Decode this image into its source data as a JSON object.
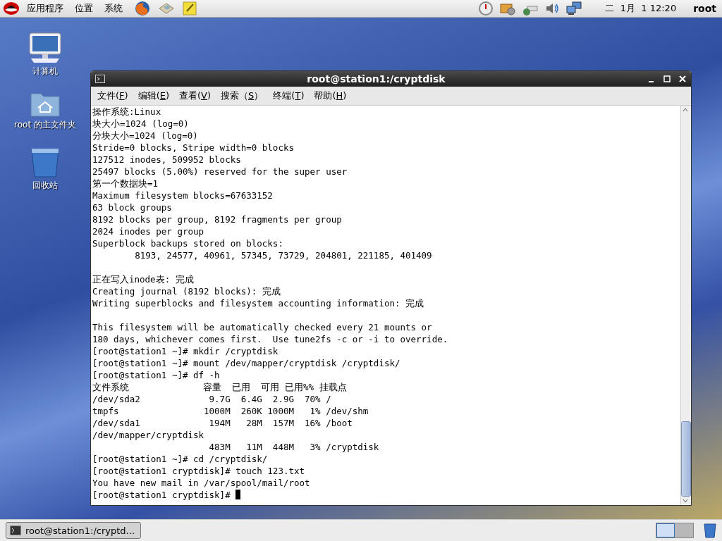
{
  "top_panel": {
    "menus": [
      "应用程序",
      "位置",
      "系统"
    ],
    "clock": "二  1月  1 12:20",
    "user": "root"
  },
  "desktop_icons": [
    {
      "kind": "computer",
      "label": "计算机"
    },
    {
      "kind": "home",
      "label": "root 的主文件夹"
    },
    {
      "kind": "trash",
      "label": "回收站"
    }
  ],
  "window": {
    "title": "root@station1:/cryptdisk",
    "menu": [
      {
        "before": "文件(",
        "key": "F",
        "after": ")"
      },
      {
        "before": "编辑(",
        "key": "E",
        "after": ")"
      },
      {
        "before": "查看(",
        "key": "V",
        "after": ")"
      },
      {
        "before": "搜索（",
        "key": "S",
        "after": "）"
      },
      {
        "before": "终端(",
        "key": "T",
        "after": ")"
      },
      {
        "before": "帮助(",
        "key": "H",
        "after": ")"
      }
    ],
    "terminal": {
      "cursor_visible": true,
      "lines": [
        {
          "kind": "text",
          "text": "操作系统:Linux"
        },
        {
          "kind": "text",
          "text": "块大小=1024 (log=0)"
        },
        {
          "kind": "text",
          "text": "分块大小=1024 (log=0)"
        },
        {
          "kind": "text",
          "text": "Stride=0 blocks, Stripe width=0 blocks"
        },
        {
          "kind": "text",
          "text": "127512 inodes, 509952 blocks"
        },
        {
          "kind": "text",
          "text": "25497 blocks (5.00%) reserved for the super user"
        },
        {
          "kind": "text",
          "text": "第一个数据块=1"
        },
        {
          "kind": "text",
          "text": "Maximum filesystem blocks=67633152"
        },
        {
          "kind": "text",
          "text": "63 block groups"
        },
        {
          "kind": "text",
          "text": "8192 blocks per group, 8192 fragments per group"
        },
        {
          "kind": "text",
          "text": "2024 inodes per group"
        },
        {
          "kind": "text",
          "text": "Superblock backups stored on blocks:"
        },
        {
          "kind": "text",
          "text": "        8193, 24577, 40961, 57345, 73729, 204801, 221185, 401409"
        },
        {
          "kind": "blank"
        },
        {
          "kind": "text",
          "text": "正在写入inode表: 完成"
        },
        {
          "kind": "text",
          "text": "Creating journal (8192 blocks): 完成"
        },
        {
          "kind": "text",
          "text": "Writing superblocks and filesystem accounting information: 完成"
        },
        {
          "kind": "blank"
        },
        {
          "kind": "text",
          "text": "This filesystem will be automatically checked every 21 mounts or"
        },
        {
          "kind": "text",
          "text": "180 days, whichever comes first.  Use tune2fs -c or -i to override."
        },
        {
          "kind": "text",
          "text": "[root@station1 ~]# mkdir /cryptdisk"
        },
        {
          "kind": "text",
          "text": "[root@station1 ~]# mount /dev/mapper/cryptdisk /cryptdisk/"
        },
        {
          "kind": "text",
          "text": "[root@station1 ~]# df -h"
        },
        {
          "kind": "text",
          "text": "文件系统              容量  已用  可用 已用%% 挂载点"
        },
        {
          "kind": "text",
          "text": "/dev/sda2             9.7G  6.4G  2.9G  70% /"
        },
        {
          "kind": "text",
          "text": "tmpfs                1000M  260K 1000M   1% /dev/shm"
        },
        {
          "kind": "text",
          "text": "/dev/sda1             194M   28M  157M  16% /boot"
        },
        {
          "kind": "text",
          "text": "/dev/mapper/cryptdisk"
        },
        {
          "kind": "text",
          "text": "                      483M   11M  448M   3% /cryptdisk"
        },
        {
          "kind": "text",
          "text": "[root@station1 ~]# cd /cryptdisk/"
        },
        {
          "kind": "text",
          "text": "[root@station1 cryptdisk]# touch 123.txt"
        },
        {
          "kind": "text",
          "text": "You have new mail in /var/spool/mail/root"
        },
        {
          "kind": "text",
          "text": "[root@station1 cryptdisk]# "
        }
      ]
    }
  },
  "taskbar": {
    "tasks": [
      {
        "label": "root@station1:/cryptd...",
        "selected": true
      }
    ],
    "workspaces": [
      {
        "selected": true
      },
      {
        "selected": false
      }
    ]
  }
}
